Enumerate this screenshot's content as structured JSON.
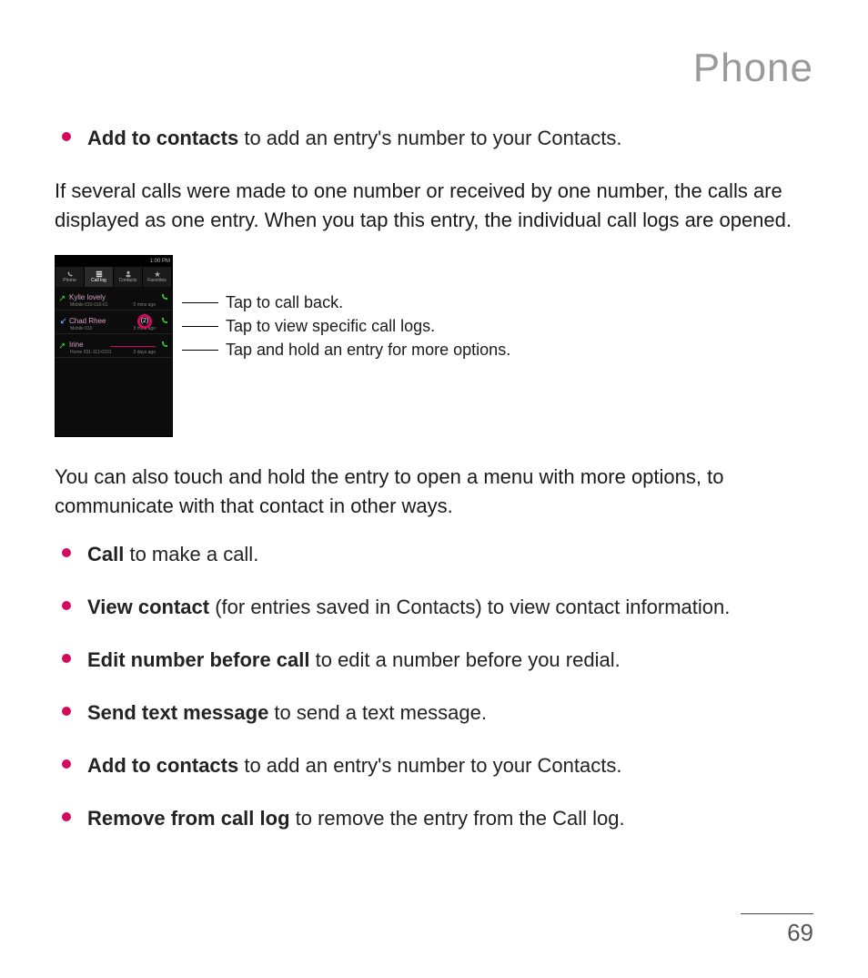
{
  "title": "Phone",
  "bullet_top": {
    "strong": "Add to contacts",
    "rest": " to add an entry's number to your Contacts."
  },
  "para1": "If several calls were made to one number or received by one number, the calls are displayed as one entry. When you tap this entry, the individual call logs are opened.",
  "mock": {
    "status_time": "1:00 PM",
    "tabs": [
      "Phone",
      "Call log",
      "Contacts",
      "Favorites"
    ],
    "rows": [
      {
        "name": "Kylie lovely",
        "sub": "Mobile 010-010-01",
        "time": "0 mins ago"
      },
      {
        "name": "Chad Rhee",
        "sub": "Mobile 010",
        "time": "3 mins ago",
        "count": "(2)"
      },
      {
        "name": "Irine",
        "sub": "Home 031-113-0101",
        "time": "3 days ago"
      }
    ]
  },
  "callouts": [
    "Tap to call back.",
    "Tap to view specific call logs.",
    "Tap and hold an entry for more options."
  ],
  "para2": "You can also touch and hold the entry to open a menu with more options, to communicate with that contact in other ways.",
  "bullets": [
    {
      "strong": "Call",
      "rest": " to make a call."
    },
    {
      "strong": "View contact",
      "rest": " (for entries saved in Contacts) to view contact information."
    },
    {
      "strong": "Edit number before call",
      "rest": " to edit a number before you redial."
    },
    {
      "strong": "Send text message",
      "rest": " to send a text message."
    },
    {
      "strong": "Add to contacts",
      "rest": " to add an entry's number to your Contacts."
    },
    {
      "strong": "Remove from call log",
      "rest": " to remove the entry from the Call log."
    }
  ],
  "page_number": "69"
}
